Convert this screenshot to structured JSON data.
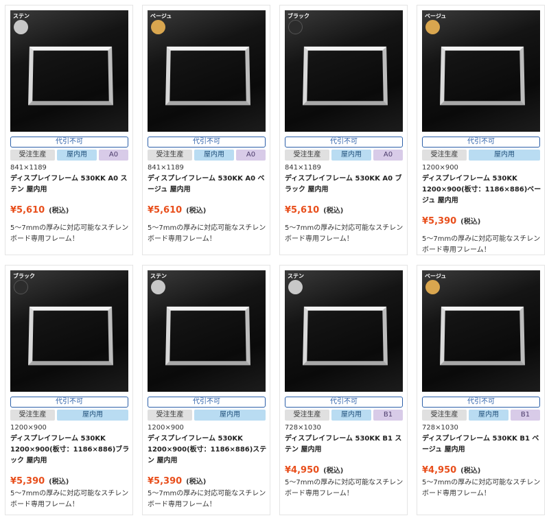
{
  "colors": {
    "sten": "#c8c8c8",
    "beige": "#d9a64f",
    "black": "#2c2c2c",
    "price": "#e84e1b",
    "notice": "#2a5ea8"
  },
  "cards": [
    {
      "swatch_label": "ステン",
      "notice": "代引不可",
      "tag1": "受注生産",
      "tag2": "屋内用",
      "tag3": "A0",
      "size": "841×1189",
      "name": "ディスプレイフレーム 530KK A0 ステン 屋内用",
      "price": "¥5,610",
      "tax": "(税込)",
      "desc": "5～7mmの厚みに対応可能なスチレンボード専用フレーム！"
    },
    {
      "swatch_label": "ベージュ",
      "notice": "代引不可",
      "tag1": "受注生産",
      "tag2": "屋内用",
      "tag3": "A0",
      "size": "841×1189",
      "name": "ディスプレイフレーム 530KK A0 ベージュ 屋内用",
      "price": "¥5,610",
      "tax": "(税込)",
      "desc": "5～7mmの厚みに対応可能なスチレンボード専用フレーム！"
    },
    {
      "swatch_label": "ブラック",
      "notice": "代引不可",
      "tag1": "受注生産",
      "tag2": "屋内用",
      "tag3": "A0",
      "size": "841×1189",
      "name": "ディスプレイフレーム 530KK A0 ブラック 屋内用",
      "price": "¥5,610",
      "tax": "(税込)",
      "desc": "5～7mmの厚みに対応可能なスチレンボード専用フレーム！"
    },
    {
      "swatch_label": "ベージュ",
      "notice": "代引不可",
      "tag1": "受注生産",
      "tag2": "屋内用",
      "tag3": "",
      "size": "1200×900",
      "name": "ディスプレイフレーム 530KK 1200×900(板寸：1186×886)ベージュ 屋内用",
      "price": "¥5,390",
      "tax": "(税込)",
      "desc": "5～7mmの厚みに対応可能なスチレンボード専用フレーム！"
    },
    {
      "swatch_label": "ブラック",
      "notice": "代引不可",
      "tag1": "受注生産",
      "tag2": "屋内用",
      "tag3": "",
      "size": "1200×900",
      "name": "ディスプレイフレーム 530KK 1200×900(板寸：1186×886)ブラック 屋内用",
      "price": "¥5,390",
      "tax": "(税込)",
      "desc": "5～7mmの厚みに対応可能なスチレンボード専用フレーム！"
    },
    {
      "swatch_label": "ステン",
      "notice": "代引不可",
      "tag1": "受注生産",
      "tag2": "屋内用",
      "tag3": "",
      "size": "1200×900",
      "name": "ディスプレイフレーム 530KK 1200×900(板寸：1186×886)ステン 屋内用",
      "price": "¥5,390",
      "tax": "(税込)",
      "desc": "5～7mmの厚みに対応可能なスチレンボード専用フレーム！"
    },
    {
      "swatch_label": "ステン",
      "notice": "代引不可",
      "tag1": "受注生産",
      "tag2": "屋内用",
      "tag3": "B1",
      "size": "728×1030",
      "name": "ディスプレイフレーム 530KK B1 ステン 屋内用",
      "price": "¥4,950",
      "tax": "(税込)",
      "desc": "5～7mmの厚みに対応可能なスチレンボード専用フレーム！"
    },
    {
      "swatch_label": "ベージュ",
      "notice": "代引不可",
      "tag1": "受注生産",
      "tag2": "屋内用",
      "tag3": "B1",
      "size": "728×1030",
      "name": "ディスプレイフレーム 530KK B1 ベージュ 屋内用",
      "price": "¥4,950",
      "tax": "(税込)",
      "desc": "5～7mmの厚みに対応可能なスチレンボード専用フレーム！"
    }
  ]
}
